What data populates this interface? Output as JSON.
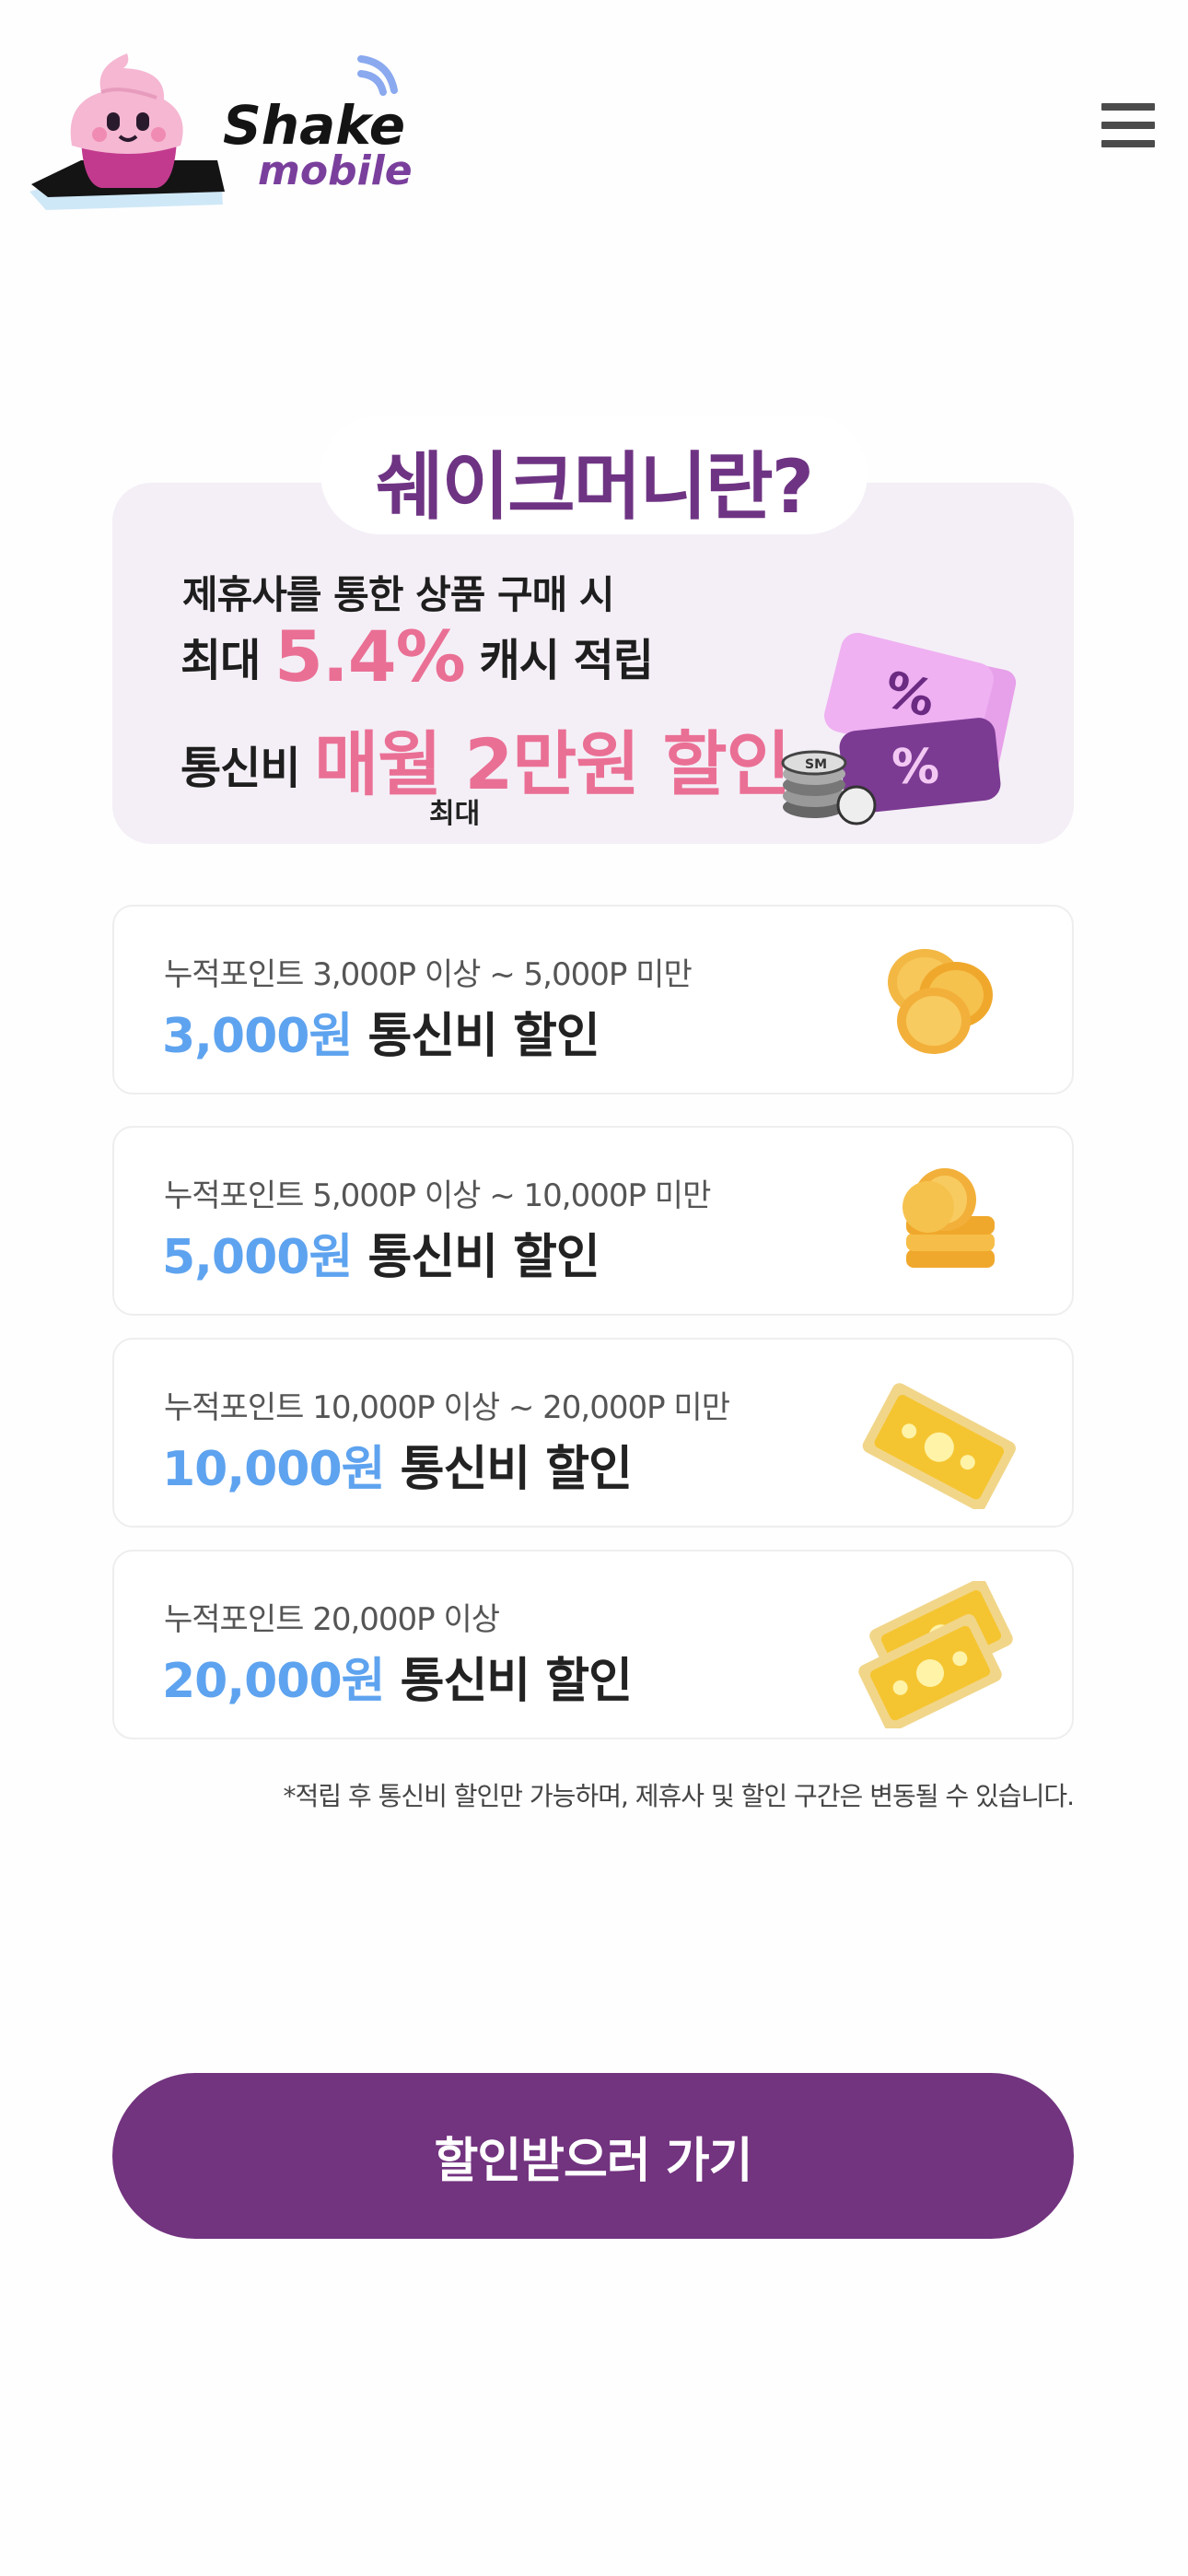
{
  "header": {
    "brand_top": "Shake",
    "brand_bottom": "mobile",
    "menu_icon": "hamburger-menu-icon"
  },
  "intro": {
    "title": "쉐이크머니란?",
    "line1": "제휴사를 통한 상품 구매 시",
    "line2_prefix": "최대",
    "line2_highlight": "5.4%",
    "line2_suffix": "캐시 적립",
    "line3_prefix": "통신비",
    "line3_highlight": "매월 2만원 할인",
    "max_note": "최대",
    "art_badge_text": "SM"
  },
  "tiers": [
    {
      "range": "누적포인트 3,000P 이상 ~ 5,000P 미만",
      "amount": "3,000원",
      "suffix": "통신비 할인",
      "icon": "coins-icon"
    },
    {
      "range": "누적포인트 5,000P 이상 ~ 10,000P 미만",
      "amount": "5,000원",
      "suffix": "통신비 할인",
      "icon": "coin-stack-icon"
    },
    {
      "range": "누적포인트 10,000P 이상 ~ 20,000P 미만",
      "amount": "10,000원",
      "suffix": "통신비 할인",
      "icon": "banknote-icon"
    },
    {
      "range": "누적포인트 20,000P 이상",
      "amount": "20,000원",
      "suffix": "통신비 할인",
      "icon": "banknotes-icon"
    }
  ],
  "disclaimer": "*적립 후 통신비 할인만 가능하며, 제휴사 및 할인 구간은 변동될 수 있습니다.",
  "cta_label": "할인받으러 가기",
  "colors": {
    "brand_purple": "#72337f",
    "title_purple": "#6e3483",
    "highlight_pink": "#ea6f95",
    "amount_blue": "#5ea3ef",
    "intro_bg": "#f4eff6"
  }
}
